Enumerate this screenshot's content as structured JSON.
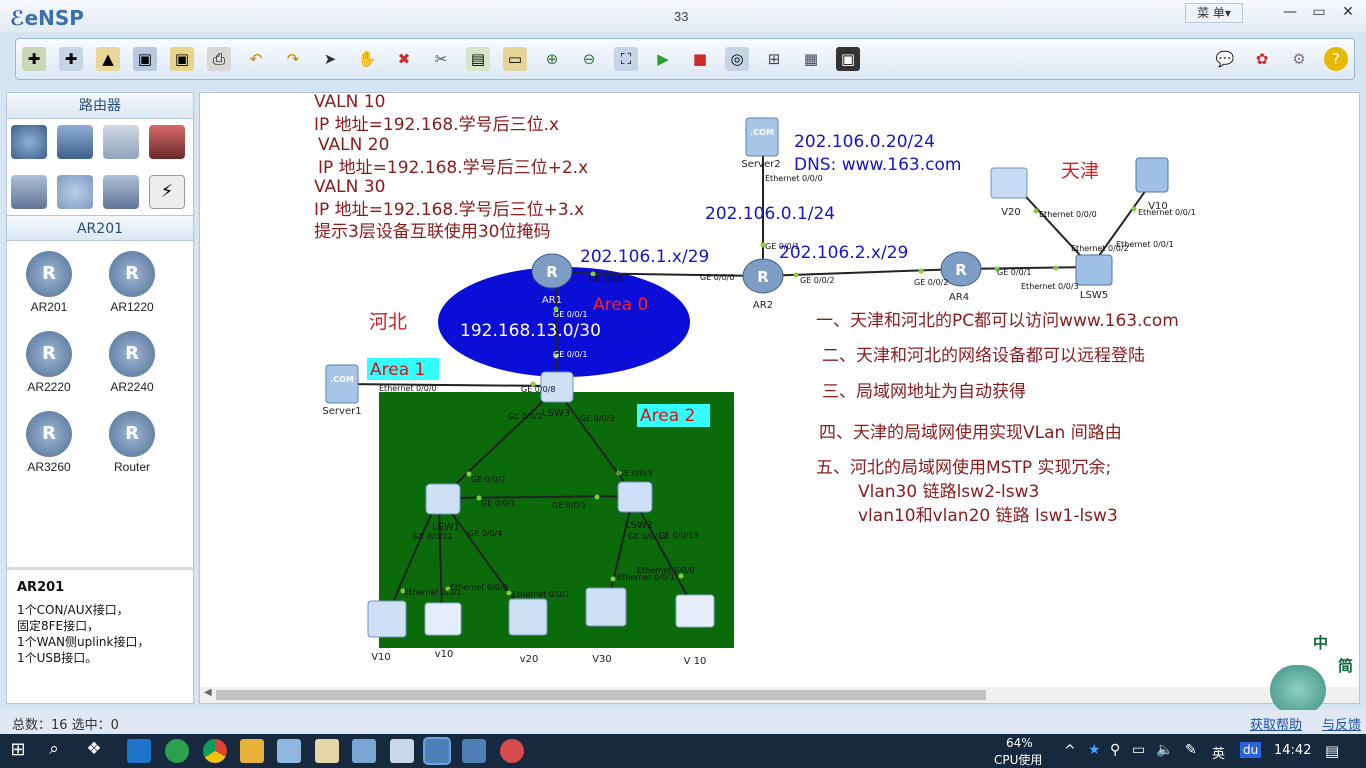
{
  "app": {
    "name": "eNSP",
    "window_title": "33",
    "menu_label": "菜 单▾"
  },
  "window_controls": {
    "minimize": "—",
    "maximize": "▭",
    "close": "✕"
  },
  "toolbar": {
    "icons": [
      "new-topology-icon",
      "new-config-icon",
      "open-icon",
      "save-icon",
      "save-as-icon",
      "print-icon",
      "undo-icon",
      "redo-icon",
      "select-icon",
      "pan-hand-icon",
      "delete-icon",
      "delete-link-icon",
      "text-note-icon",
      "rectangle-icon",
      "zoom-in-icon",
      "zoom-out-icon",
      "fit-view-icon",
      "start-device-icon",
      "stop-device-icon",
      "capture-icon",
      "topology-view-icon",
      "grid-icon",
      "console-icon"
    ],
    "right_icons": [
      "chat-icon",
      "huawei-logo-icon",
      "settings-icon",
      "help-icon"
    ]
  },
  "left_panel": {
    "category_title": "路由器",
    "subcategory_title": "AR201",
    "devices": [
      {
        "name": "AR201"
      },
      {
        "name": "AR1220"
      },
      {
        "name": "AR2220"
      },
      {
        "name": "AR2240"
      },
      {
        "name": "AR3260"
      },
      {
        "name": "Router"
      }
    ],
    "description_title": "AR201",
    "description_lines": [
      "1个CON/AUX接口，",
      "固定8FE接口，",
      "1个WAN侧uplink接口，",
      "1个USB接口。"
    ]
  },
  "notes": {
    "left": [
      "VALN 10",
      "IP 地址=192.168.学号后三位.x",
      "VALN 20",
      "IP 地址=192.168.学号后三位+2.x",
      "VALN 30",
      "IP 地址=192.168.学号后三位+3.x",
      "提示3层设备互联使用30位掩码"
    ],
    "requirements": [
      "一、天津和河北的PC都可以访问www.163.com",
      "二、天津和河北的网络设备都可以远程登陆",
      "三、局域网地址为自动获得",
      "四、天津的局域网使用实现VLan 间路由",
      "五、河北的局域网使用MSTP 实现冗余;",
      "Vlan30 链路lsw2-lsw3",
      "vlan10和vlan20 链路 lsw1-lsw3"
    ]
  },
  "topology": {
    "region_tianjin": "天津",
    "region_hebei": "河北",
    "area0": "Area 0",
    "area1": "Area 1",
    "area2": "Area 2",
    "area0_net": "192.168.13.0/30",
    "server2_ip": "202.106.0.20/24",
    "server2_dns": "DNS: www.163.com",
    "ar2_server_net": "202.106.0.1/24",
    "ar1_ar2_net": "202.106.1.x/29",
    "ar2_ar4_net": "202.106.2.x/29",
    "devices": {
      "server2": "Server2",
      "server1": "Server1",
      "ar1": "AR1",
      "ar2": "AR2",
      "ar4": "AR4",
      "lsw5": "LSW5",
      "lsw3": "LSW3",
      "lsw1": "LSW1",
      "lsw2": "LSW2",
      "tj_v20": "V20",
      "tj_v10": "V10",
      "hb_pc1": "V10",
      "hb_pc2": "v10",
      "hb_pc3": "v20",
      "hb_pc4": "V30",
      "hb_pc5": "V 10"
    },
    "ports": {
      "server2_eth": "Ethernet 0/0/0",
      "ar2_ge001_top": "GE 0/0/1",
      "ar1_ge000": "GE 0/0/0",
      "ar2_ge000": "GE 0/0/0",
      "ar2_ge002": "GE 0/0/2",
      "ar4_ge002": "GE 0/0/2",
      "ar4_ge001": "GE 0/0/1",
      "lsw5_eth003": "Ethernet 0/0/3",
      "lsw5_eth002": "Ethernet 0/0/2",
      "lsw5_eth001b": "Ethernet 0/0/1",
      "v20_eth000": "Ethernet 0/0/0",
      "v10_eth001": "Ethernet 0/0/1",
      "ar1_ge001": "GE 0/0/1",
      "lsw3_ge001": "GE 0/0/1",
      "server1_eth": "Ethernet 0/0/0",
      "lsw3_ge008": "GE 0/0/8",
      "lsw3_ge002": "GE 0/0/2",
      "lsw3_ge003": "GE 0/0/3",
      "lsw1_ge002": "GE 0/0/2",
      "lsw2_ge003": "GE 0/0/3",
      "lsw1_ge001": "GE 0/0/1",
      "lsw2_ge001": "GE 0/0/1",
      "lsw1_ports": "GE 0/0/11",
      "lsw1_ge004": "GE 0/0/4",
      "lsw2_ge0012": "GE 0/0/12",
      "lsw2_ge0013": "GE 0/0/13",
      "pc1_eth": "Ethernet 0/0/1",
      "pc2_eth": "Ethernet 0/0/0",
      "pc3_eth": "Ethernet 0/0/1",
      "pc4_eth": "Ethernet 0/0/1",
      "pc5_eth": "Ethernet 0/0/0"
    }
  },
  "status_bar": {
    "summary": "总数：16 选中：0",
    "help_left": "获取帮助",
    "help_right": "与反馈"
  },
  "ime_float": {
    "a": "中",
    "b": "简"
  },
  "taskbar": {
    "cpu_percent": "64%",
    "cpu_label": "CPU使用",
    "lang": "英",
    "baidu": "du",
    "time": "14:42"
  },
  "colors": {
    "area0_fill": "#0a0ed6",
    "area2_fill": "#0b6b0b",
    "area_label_bg": "#33ffff",
    "note_left": "#8b1b1b",
    "note_blue": "#1515c8",
    "area_label_red": "#ff2020"
  }
}
